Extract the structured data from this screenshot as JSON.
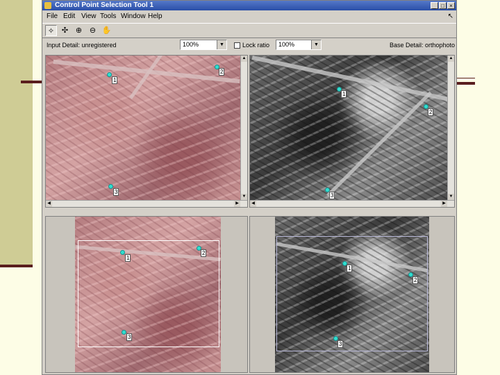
{
  "window": {
    "title": "Control Point Selection Tool 1",
    "buttons": {
      "minimize": "_",
      "maximize": "□",
      "close": "×"
    }
  },
  "menu": {
    "items": [
      "File",
      "Edit",
      "View",
      "Tools",
      "Window",
      "Help"
    ],
    "help_icon": "↖"
  },
  "toolbar": {
    "tools": [
      {
        "icon": "point-select-icon",
        "glyph": "✧"
      },
      {
        "icon": "point-prediction-icon",
        "glyph": "✣"
      },
      {
        "icon": "zoom-in-icon",
        "glyph": "⊕"
      },
      {
        "icon": "zoom-out-icon",
        "glyph": "⊖"
      },
      {
        "icon": "pan-hand-icon",
        "glyph": "✋"
      }
    ]
  },
  "controls": {
    "input_label": "Input Detail: unregistered",
    "input_zoom": "100%",
    "lock_label": "Lock ratio",
    "base_zoom": "100%",
    "base_label": "Base Detail: orthophoto"
  },
  "points": {
    "p1": "1",
    "p2": "2",
    "p3": "3"
  },
  "colors": {
    "point_fill": "#30e0d0",
    "title_bar": "#2a4fa8"
  }
}
